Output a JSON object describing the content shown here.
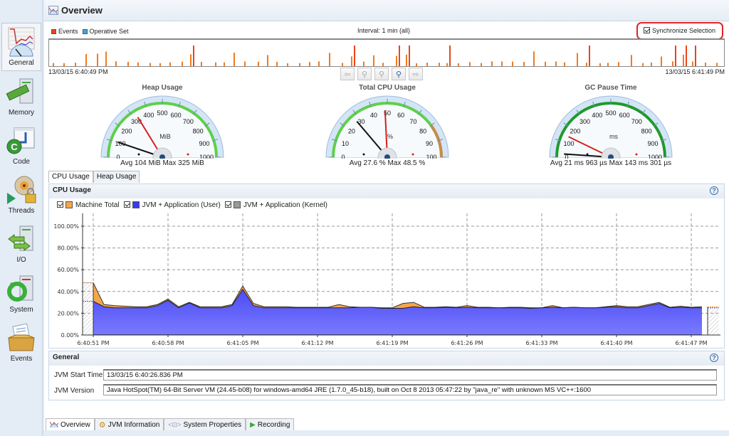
{
  "sidebar": {
    "items": [
      {
        "label": "General",
        "icon": "general-gauge-icon",
        "active": true
      },
      {
        "label": "Memory",
        "icon": "memory-icon"
      },
      {
        "label": "Code",
        "icon": "code-icon"
      },
      {
        "label": "Threads",
        "icon": "threads-icon"
      },
      {
        "label": "I/O",
        "icon": "io-icon"
      },
      {
        "label": "System",
        "icon": "system-icon"
      },
      {
        "label": "Events",
        "icon": "events-icon"
      }
    ]
  },
  "header": {
    "title": "Overview"
  },
  "timeline": {
    "legend": [
      {
        "label": "Events",
        "color": "#e8451c"
      },
      {
        "label": "Operative Set",
        "color": "#3fa9dc"
      }
    ],
    "interval": "Interval: 1 min (all)",
    "sync_label": "Synchronize Selection",
    "sync_checked": true,
    "start": "13/03/15 6:40:49 PM",
    "end": "13/03/15 6:41:49 PM",
    "nav_buttons": [
      "back",
      "zoom-out",
      "zoom-all",
      "zoom-in",
      "forward"
    ]
  },
  "gauges": [
    {
      "title": "Heap Usage",
      "unit": "MiB",
      "ticks": [
        "0",
        "100",
        "200",
        "300",
        "400",
        "500",
        "600",
        "700",
        "800",
        "900",
        "1000"
      ],
      "max_scale": 1000,
      "avg_value": 104,
      "max_value": 325,
      "summary": "Avg 104 MiB   Max 325 MiB",
      "arc_color": "#5fcf4a"
    },
    {
      "title": "Total CPU Usage",
      "unit": "%",
      "ticks": [
        "0",
        "10",
        "20",
        "30",
        "40",
        "50",
        "60",
        "70",
        "80",
        "90",
        "100"
      ],
      "max_scale": 100,
      "avg_value": 27.6,
      "max_value": 48.5,
      "summary": "Avg 27.6 %   Max 48.5 %",
      "arc_color": "#5fcf4a"
    },
    {
      "title": "GC Pause Time",
      "unit": "ms",
      "ticks": [
        "0",
        "100",
        "200",
        "300",
        "400",
        "500",
        "600",
        "700",
        "800",
        "900",
        "1000"
      ],
      "max_scale": 1000,
      "avg_value": 21.963,
      "max_value": 143.301,
      "summary": "Avg 21 ms 963 µs   Max 143 ms 301 µs",
      "arc_color": "#1f9a2a"
    }
  ],
  "cpu_tabs": [
    {
      "label": "CPU Usage",
      "active": true
    },
    {
      "label": "Heap Usage"
    }
  ],
  "cpu_section": {
    "title": "CPU Usage",
    "help": "?",
    "legend": [
      {
        "label": "Machine Total",
        "color": "#f7a54a",
        "checked": true
      },
      {
        "label": "JVM + Application (User)",
        "color": "#3a3af0",
        "checked": true
      },
      {
        "label": "JVM + Application (Kernel)",
        "color": "#9a9a9a",
        "checked": true
      }
    ]
  },
  "chart_data": {
    "type": "area",
    "title": "CPU Usage",
    "xlabel": "",
    "ylabel": "",
    "ylim": [
      0,
      100
    ],
    "yticks": [
      "0.00%",
      "20.00%",
      "40.00%",
      "60.00%",
      "80.00%",
      "100.00%"
    ],
    "xticks": [
      "6:40:51 PM",
      "6:40:58 PM",
      "6:41:05 PM",
      "6:41:12 PM",
      "6:41:19 PM",
      "6:41:26 PM",
      "6:41:33 PM",
      "6:41:40 PM",
      "6:41:47 PM"
    ],
    "x_seconds": [
      0,
      1,
      2,
      3,
      4,
      5,
      6,
      7,
      8,
      9,
      10,
      11,
      12,
      13,
      14,
      15,
      16,
      17,
      18,
      19,
      20,
      21,
      22,
      23,
      24,
      25,
      26,
      27,
      28,
      29,
      30,
      31,
      32,
      33,
      34,
      35,
      36,
      37,
      38,
      39,
      40,
      41,
      42,
      43,
      44,
      45,
      46,
      47,
      48,
      49,
      50,
      51,
      52,
      53,
      54,
      55,
      56,
      57
    ],
    "series": [
      {
        "name": "Machine Total",
        "values": [
          48,
          28,
          27,
          26.5,
          26,
          26,
          28,
          33,
          26,
          30,
          26,
          26,
          26,
          28,
          45,
          29,
          26,
          26,
          26,
          25.5,
          25.5,
          25.5,
          25.5,
          28,
          26,
          25.5,
          25.5,
          25,
          25,
          29,
          30,
          25.5,
          25.5,
          26,
          25.5,
          27,
          25.5,
          25.5,
          25,
          25.5,
          25.5,
          25,
          25,
          27,
          25,
          25.5,
          25,
          25,
          26,
          27,
          26,
          26,
          28,
          30,
          25.5,
          26.5,
          25.5,
          26
        ]
      },
      {
        "name": "JVM + Application (User)",
        "values": [
          31,
          26,
          25,
          25,
          25,
          25,
          27,
          32,
          25,
          29.5,
          25,
          25,
          25,
          27,
          42,
          27,
          25,
          25,
          25,
          25,
          25,
          25,
          25,
          25,
          25,
          25.5,
          25.5,
          24.5,
          24.5,
          24.5,
          26,
          25,
          25,
          25.5,
          25,
          25.5,
          25,
          25,
          25,
          25,
          25,
          24.5,
          25,
          25.5,
          25,
          25.5,
          25,
          25,
          25.5,
          26,
          25,
          25,
          27,
          29,
          25,
          25.5,
          25,
          25
        ]
      },
      {
        "name": "JVM + Application (Kernel)",
        "values": [
          0.5,
          0.5,
          0.5,
          0.5,
          0.5,
          0.5,
          0.5,
          0.5,
          0.5,
          0.5,
          0.5,
          0.5,
          0.5,
          0.5,
          0.5,
          0.5,
          0.5,
          0.5,
          0.5,
          0.5,
          0.5,
          0.5,
          0.5,
          0.5,
          0.5,
          0.5,
          0.5,
          0.5,
          0.5,
          0.5,
          0.5,
          0.5,
          0.5,
          0.5,
          0.5,
          0.5,
          0.5,
          0.5,
          0.5,
          0.5,
          0.5,
          0.5,
          0.5,
          0.5,
          0.5,
          0.5,
          0.5,
          0.5,
          0.5,
          0.5,
          0.5,
          0.5,
          0.5,
          0.5,
          0.5,
          0.5,
          0.5,
          0.5
        ]
      }
    ],
    "grid": true
  },
  "general_section": {
    "title": "General",
    "help": "?",
    "rows": [
      {
        "label": "JVM Start Time",
        "value": "13/03/15 6:40:26.836 PM"
      },
      {
        "label": "JVM Version",
        "value": "Java HotSpot(TM) 64-Bit Server VM (24.45-b08) for windows-amd64 JRE (1.7.0_45-b18), built on Oct  8 2013 05:47:22 by \"java_re\" with unknown MS VC++:1600"
      }
    ]
  },
  "bottom_tabs": [
    {
      "label": "Overview",
      "icon": "overview-icon",
      "active": true
    },
    {
      "label": "JVM Information",
      "icon": "gears-icon"
    },
    {
      "label": "System Properties",
      "icon": "properties-icon"
    },
    {
      "label": "Recording",
      "icon": "play-icon"
    }
  ]
}
